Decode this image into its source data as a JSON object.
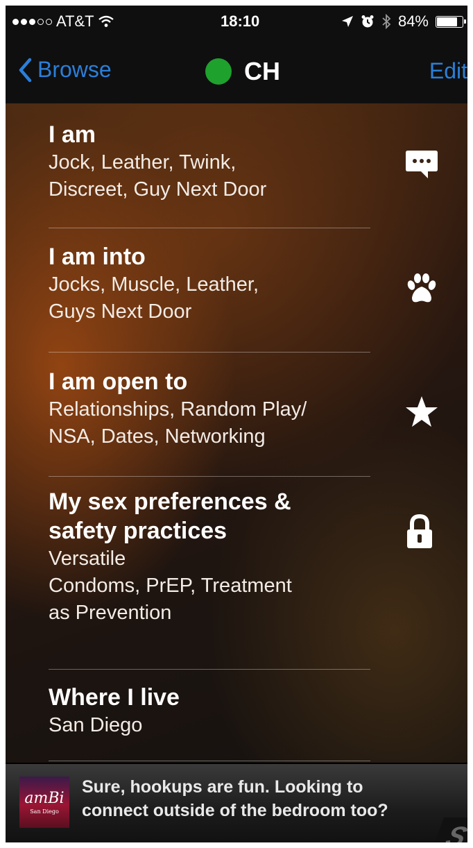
{
  "status_bar": {
    "carrier": "AT&T",
    "signal_bars_filled": 3,
    "signal_bars_total": 5,
    "time": "18:10",
    "battery_text": "84%",
    "battery_level": 0.84
  },
  "nav": {
    "back_label": "Browse",
    "title": "CH",
    "edit_label": "Edit",
    "online_color": "#1fa12d",
    "accent_color": "#2a7fd9"
  },
  "sections": [
    {
      "title": "I am",
      "lines": [
        "Jock, Leather, Twink,",
        "Discreet, Guy Next Door"
      ],
      "icon": "chat-bubble-icon"
    },
    {
      "title": "I am into",
      "lines": [
        "Jocks, Muscle, Leather,",
        "Guys Next Door"
      ],
      "icon": "paw-icon"
    },
    {
      "title": "I am open to",
      "lines": [
        "Relationships, Random Play/",
        "NSA, Dates, Networking"
      ],
      "icon": "star-icon"
    },
    {
      "title_lines": [
        "My sex preferences &",
        "safety practices"
      ],
      "lines": [
        "Versatile",
        "Condoms, PrEP, Treatment",
        "as Prevention"
      ],
      "icon": "lock-icon"
    },
    {
      "title": "Where I live",
      "lines": [
        "San Diego"
      ]
    }
  ],
  "ad": {
    "logo_text": "amBi",
    "logo_subtext": "San Diego",
    "text_lines": [
      "Sure, hookups are fun. Looking to",
      "connect outside of the bedroom too?"
    ],
    "corner_text": "S"
  }
}
